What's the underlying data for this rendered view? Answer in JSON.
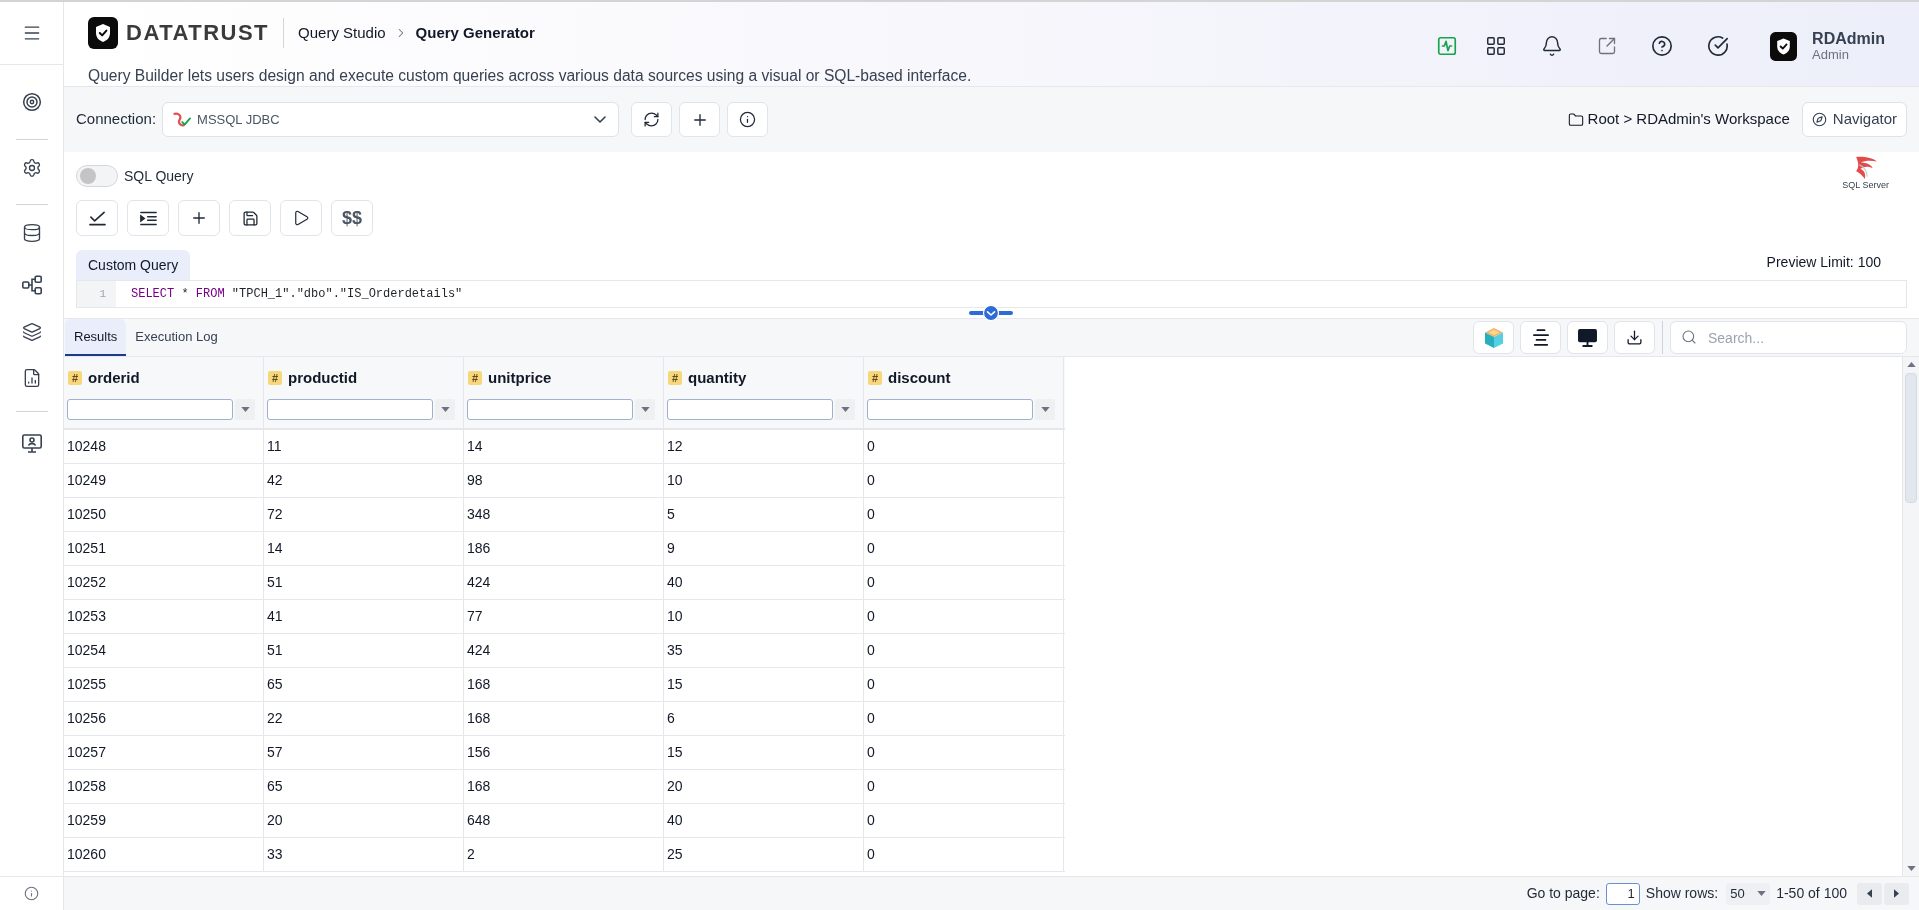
{
  "header": {
    "brand": "DATATRUST",
    "breadcrumb": [
      {
        "label": "Query Studio",
        "current": false
      },
      {
        "label": "Query Generator",
        "current": true
      }
    ],
    "description": "Query Builder lets users design and execute custom queries across various data sources using a visual or SQL-based interface.",
    "user": {
      "name": "RDAdmin",
      "role": "Admin"
    }
  },
  "connection_bar": {
    "label": "Connection:",
    "connection": "MSSQL JDBC",
    "workspace_path": "Root > RDAdmin's Workspace",
    "navigator_button": "Navigator"
  },
  "editor": {
    "sql_toggle": {
      "label": "SQL Query",
      "on": false
    },
    "engine_logo": "SQL Server",
    "toolbar_text_button": "$$",
    "tabs": [
      {
        "label": "Custom Query",
        "selected": true
      }
    ],
    "preview_limit": "Preview Limit: 100",
    "lines": [
      {
        "number": "1",
        "tokens": [
          {
            "kind": "keyword",
            "text": "SELECT"
          },
          {
            "kind": "plain",
            "text": " * "
          },
          {
            "kind": "keyword",
            "text": "FROM"
          },
          {
            "kind": "plain",
            "text": " \"TPCH_1\".\"dbo\".\"IS_Orderdetails\""
          }
        ]
      }
    ]
  },
  "results": {
    "tabs": [
      {
        "label": "Results",
        "selected": true
      },
      {
        "label": "Execution Log",
        "selected": false
      }
    ],
    "search": {
      "placeholder": "Search..."
    },
    "table": {
      "columns": [
        {
          "name": "orderid",
          "type_mark": "#"
        },
        {
          "name": "productid",
          "type_mark": "#"
        },
        {
          "name": "unitprice",
          "type_mark": "#"
        },
        {
          "name": "quantity",
          "type_mark": "#"
        },
        {
          "name": "discount",
          "type_mark": "#"
        }
      ],
      "rows": [
        [
          "10248",
          "11",
          "14",
          "12",
          "0"
        ],
        [
          "10249",
          "42",
          "98",
          "10",
          "0"
        ],
        [
          "10250",
          "72",
          "348",
          "5",
          "0"
        ],
        [
          "10251",
          "14",
          "186",
          "9",
          "0"
        ],
        [
          "10252",
          "51",
          "424",
          "40",
          "0"
        ],
        [
          "10253",
          "41",
          "77",
          "10",
          "0"
        ],
        [
          "10254",
          "51",
          "424",
          "35",
          "0"
        ],
        [
          "10255",
          "65",
          "168",
          "15",
          "0"
        ],
        [
          "10256",
          "22",
          "168",
          "6",
          "0"
        ],
        [
          "10257",
          "57",
          "156",
          "15",
          "0"
        ],
        [
          "10258",
          "65",
          "168",
          "20",
          "0"
        ],
        [
          "10259",
          "20",
          "648",
          "40",
          "0"
        ],
        [
          "10260",
          "33",
          "2",
          "25",
          "0"
        ]
      ]
    },
    "pagination": {
      "go_to_label": "Go to page:",
      "page": "1",
      "show_rows_label": "Show rows:",
      "rows_per_page": "50",
      "range": "1-50 of 100"
    }
  }
}
